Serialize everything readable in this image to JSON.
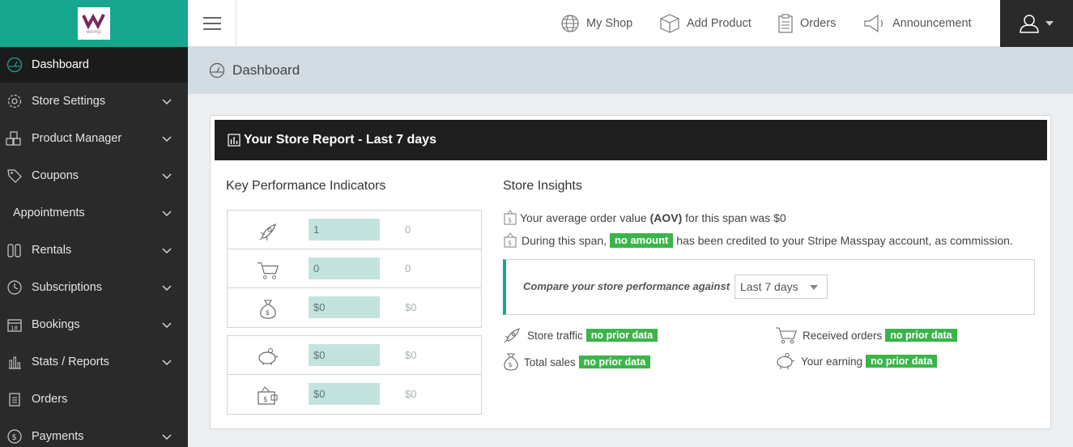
{
  "logo": {
    "text": "womp"
  },
  "sidebar": {
    "items": [
      {
        "label": "Dashboard"
      },
      {
        "label": "Store Settings"
      },
      {
        "label": "Product Manager"
      },
      {
        "label": "Coupons"
      },
      {
        "label": "Appointments"
      },
      {
        "label": "Rentals"
      },
      {
        "label": "Subscriptions"
      },
      {
        "label": "Bookings"
      },
      {
        "label": "Stats / Reports"
      },
      {
        "label": "Orders"
      },
      {
        "label": "Payments"
      }
    ]
  },
  "topbar": {
    "my_shop": "My Shop",
    "add_product": "Add Product",
    "orders": "Orders",
    "announcement": "Announcement"
  },
  "breadcrumb": {
    "title": "Dashboard"
  },
  "report": {
    "title": "Your Store Report - Last 7 days",
    "kpi_title": "Key Performance Indicators",
    "kpi": [
      {
        "value": "1",
        "prev": "0"
      },
      {
        "value": "0",
        "prev": "0"
      },
      {
        "value": "$0",
        "prev": "$0"
      },
      {
        "value": "$0",
        "prev": "$0"
      },
      {
        "value": "$0",
        "prev": "$0"
      }
    ],
    "insights_title": "Store Insights",
    "aov_prefix": "Your average order value ",
    "aov_bold": "(AOV)",
    "aov_suffix": " for this span was $0",
    "credit_prefix": "During this span, ",
    "credit_badge": "no amount",
    "credit_suffix": " has been credited to your Stripe Masspay account, as commission.",
    "compare_label": "Compare your store performance against",
    "compare_value": "Last 7 days",
    "stats": {
      "store_traffic": "Store traffic",
      "received_orders": "Received orders",
      "total_sales": "Total sales",
      "your_earning": "Your earning",
      "no_prior": "no prior data"
    }
  },
  "colors": {
    "accent": "#17a78f",
    "sidebar": "#2a2a2a",
    "badge": "#3bb54a"
  }
}
